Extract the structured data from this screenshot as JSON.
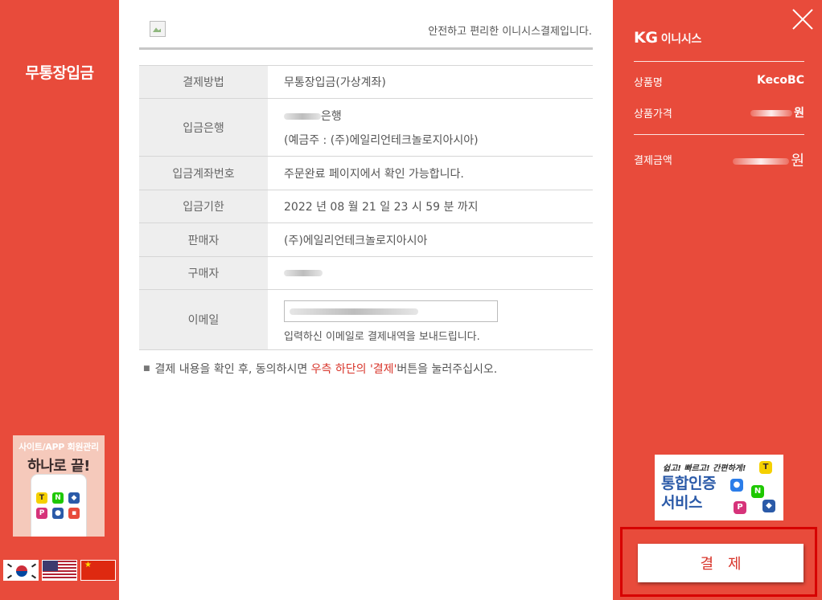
{
  "left": {
    "title": "무통장입금",
    "promo": {
      "line1": "사이트/APP 회원관리",
      "line2": "하나로 끝!"
    },
    "flags": [
      "korea-flag",
      "usa-flag",
      "china-flag"
    ]
  },
  "header": {
    "tagline": "안전하고 편리한 이니시스결제입니다."
  },
  "info": {
    "method_label": "결제방법",
    "method_value": "무통장입금(가상계좌)",
    "bank_label": "입금은행",
    "bank_suffix": "은행",
    "bank_holder": "(예금주 : (주)에일리언테크놀로지아시아)",
    "account_label": "입금계좌번호",
    "account_value": "주문완료 페이지에서 확인 가능합니다.",
    "deadline_label": "입금기한",
    "deadline_value": "2022 년 08 월 21 일 23 시 59 분 까지",
    "seller_label": "판매자",
    "seller_value": "(주)에일리언테크놀로지아시아",
    "buyer_label": "구매자",
    "email_label": "이메일",
    "email_note": "입력하신 이메일로 결제내역을 보내드립니다."
  },
  "notice": {
    "before": "결제 내용을 확인 후, 동의하시면 ",
    "highlight": "우측 하단의 '결제'",
    "after": "버튼을 눌러주십시오."
  },
  "summary": {
    "logo_kg": "KG",
    "logo_name": "이니시스",
    "product_label": "상품명",
    "product_value": "KecoBC",
    "price_label": "상품가격",
    "currency": "원",
    "total_label": "결제금액"
  },
  "cert": {
    "line1": "쉽고! 빠르고! 간편하게!",
    "line2a": "통합인증",
    "line2b": "서비스"
  },
  "pay_button": "결제",
  "colors": {
    "brand_red": "#e84b3b",
    "highlight": "#d8342a",
    "frame": "#d60000"
  }
}
